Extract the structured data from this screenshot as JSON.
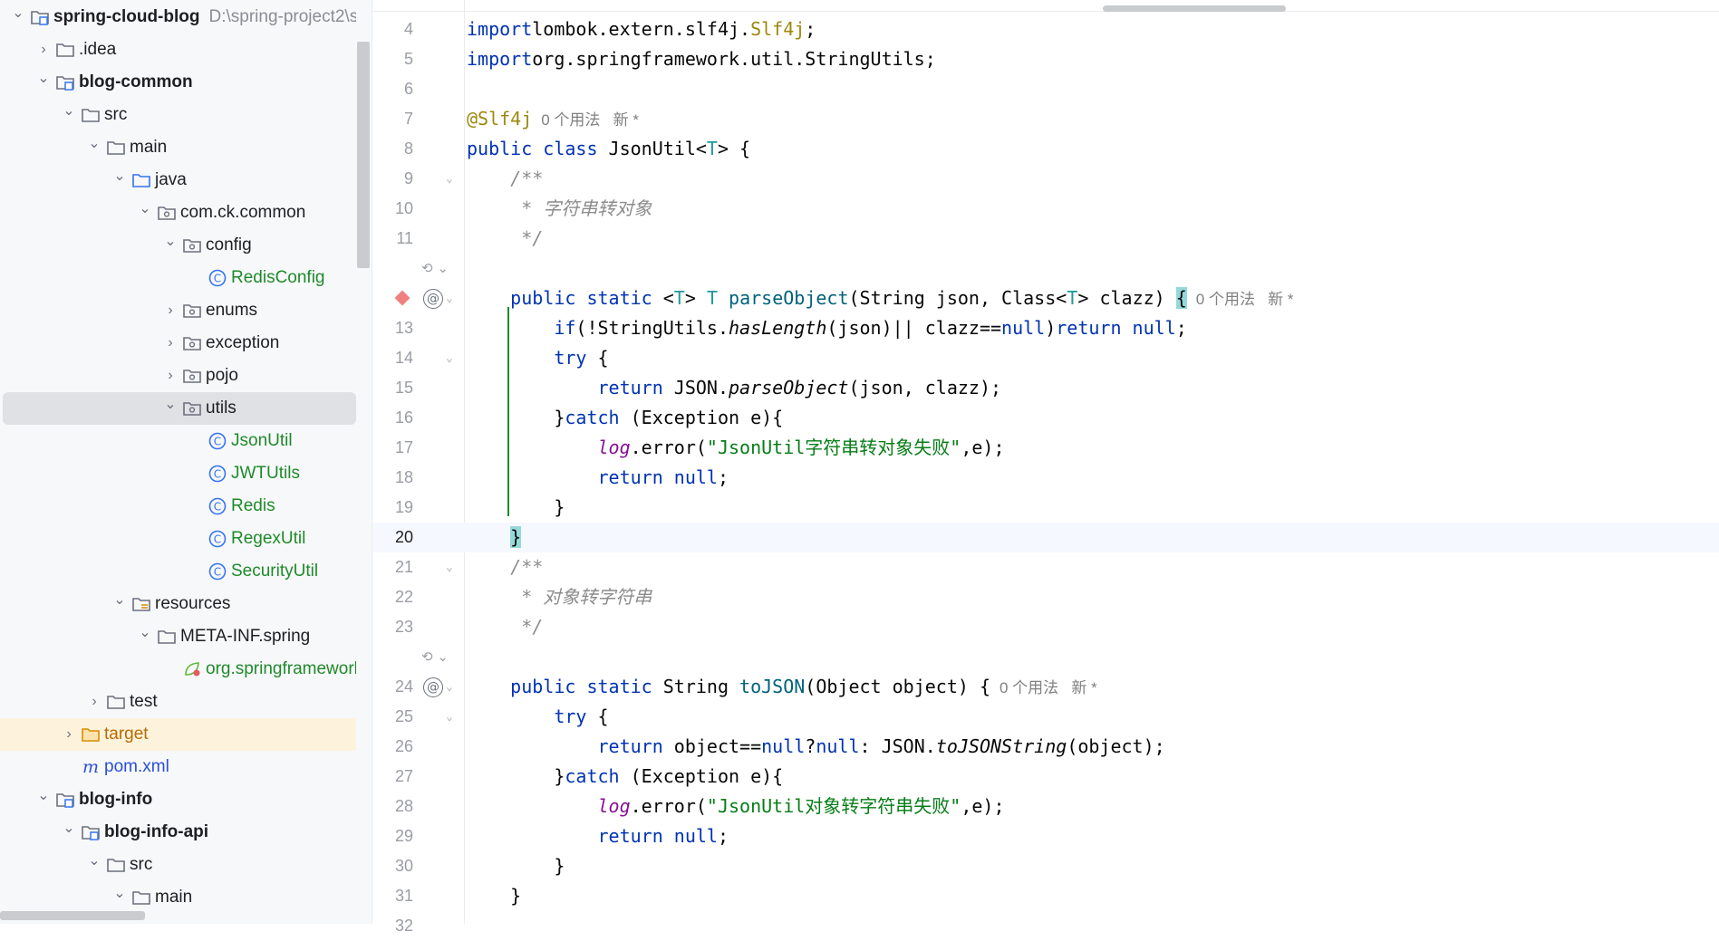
{
  "project_tree": {
    "items": [
      {
        "label": "spring-cloud-blog",
        "path": "D:\\spring-project2\\s",
        "icon": "module-folder-icon",
        "expanded": true,
        "bold": true
      },
      {
        "label": ".idea",
        "icon": "folder-icon",
        "expanded": false
      },
      {
        "label": "blog-common",
        "icon": "module-folder-icon",
        "expanded": true,
        "bold": true
      },
      {
        "label": "src",
        "icon": "folder-icon",
        "expanded": true
      },
      {
        "label": "main",
        "icon": "folder-icon",
        "expanded": true
      },
      {
        "label": "java",
        "icon": "source-folder-icon",
        "expanded": true
      },
      {
        "label": "com.ck.common",
        "icon": "package-icon",
        "expanded": true
      },
      {
        "label": "config",
        "icon": "package-icon",
        "expanded": true
      },
      {
        "label": "RedisConfig",
        "icon": "class-icon"
      },
      {
        "label": "enums",
        "icon": "package-icon",
        "expanded": false
      },
      {
        "label": "exception",
        "icon": "package-icon",
        "expanded": false
      },
      {
        "label": "pojo",
        "icon": "package-icon",
        "expanded": false
      },
      {
        "label": "utils",
        "icon": "package-icon",
        "expanded": true,
        "selected": true
      },
      {
        "label": "JsonUtil",
        "icon": "class-icon"
      },
      {
        "label": "JWTUtils",
        "icon": "class-icon"
      },
      {
        "label": "Redis",
        "icon": "class-icon"
      },
      {
        "label": "RegexUtil",
        "icon": "class-icon"
      },
      {
        "label": "SecurityUtil",
        "icon": "class-icon"
      },
      {
        "label": "resources",
        "icon": "resources-folder-icon",
        "expanded": true
      },
      {
        "label": "META-INF.spring",
        "icon": "folder-icon",
        "expanded": true
      },
      {
        "label": "org.springframework",
        "icon": "spring-file-icon"
      },
      {
        "label": "test",
        "icon": "folder-icon",
        "expanded": false
      },
      {
        "label": "target",
        "icon": "excluded-folder-icon",
        "expanded": false
      },
      {
        "label": "pom.xml",
        "icon": "maven-icon"
      },
      {
        "label": "blog-info",
        "icon": "module-folder-icon",
        "expanded": true,
        "bold": true
      },
      {
        "label": "blog-info-api",
        "icon": "module-folder-icon",
        "expanded": true,
        "bold": true
      },
      {
        "label": "src",
        "icon": "folder-icon",
        "expanded": true
      },
      {
        "label": "main",
        "icon": "folder-icon",
        "expanded": true
      }
    ]
  },
  "editor": {
    "current_line": "20",
    "lines": [
      {
        "n": "4",
        "tokens": [
          [
            "kw",
            "import"
          ],
          [
            "",
            "lombok.extern.slf4j."
          ],
          [
            "ann",
            "Slf4j"
          ],
          [
            "",
            ";"
          ]
        ]
      },
      {
        "n": "5",
        "tokens": [
          [
            "kw",
            "import"
          ],
          [
            "",
            "org.springframework.util.StringUtils;"
          ]
        ]
      },
      {
        "n": "6",
        "tokens": []
      },
      {
        "n": "7",
        "tokens": [
          [
            "ann",
            "@Slf4j"
          ]
        ],
        "hint": "0 个用法   新 *"
      },
      {
        "n": "8",
        "tokens": [
          [
            "kw",
            "public class "
          ],
          [
            "",
            "JsonUtil<"
          ],
          [
            "gen",
            "T"
          ],
          [
            "",
            "> {"
          ]
        ]
      },
      {
        "n": "9",
        "tokens": [
          [
            "cmt",
            "    /**"
          ]
        ]
      },
      {
        "n": "10",
        "tokens": [
          [
            "cmt",
            "     * 字符串转对象"
          ]
        ]
      },
      {
        "n": "11",
        "tokens": [
          [
            "cmt",
            "     */"
          ]
        ]
      },
      {
        "n": "",
        "tokens": [],
        "inlay": "⟲ ⌄"
      },
      {
        "n": "",
        "tokens": [
          [
            "",
            "    "
          ],
          [
            "kw",
            "public static "
          ],
          [
            "",
            "<"
          ],
          [
            "gen",
            "T"
          ],
          [
            "",
            "> "
          ],
          [
            "gen",
            "T "
          ],
          [
            "fn",
            "parseObject"
          ],
          [
            "",
            "(String json, Class<"
          ],
          [
            "gen",
            "T"
          ],
          [
            "",
            "> clazz) "
          ],
          [
            "brace",
            "{"
          ]
        ],
        "hint": "0 个用法   新 *",
        "marks": [
          "breakpoint",
          "at"
        ]
      },
      {
        "n": "13",
        "tokens": [
          [
            "",
            "        "
          ],
          [
            "kw",
            "if"
          ],
          [
            "",
            "(!StringUtils."
          ],
          [
            "sm",
            "hasLength"
          ],
          [
            "",
            "(json)|| clazz=="
          ],
          [
            "kw",
            "null"
          ],
          [
            "",
            ")"
          ],
          [
            "kw",
            "return null"
          ],
          [
            "",
            ";"
          ]
        ]
      },
      {
        "n": "14",
        "tokens": [
          [
            "",
            "        "
          ],
          [
            "kw",
            "try"
          ],
          [
            "",
            " {"
          ]
        ]
      },
      {
        "n": "15",
        "tokens": [
          [
            "",
            "            "
          ],
          [
            "kw",
            "return "
          ],
          [
            "",
            "JSON."
          ],
          [
            "sm",
            "parseObject"
          ],
          [
            "",
            "(json, clazz);"
          ]
        ]
      },
      {
        "n": "16",
        "tokens": [
          [
            "",
            "        }"
          ],
          [
            "kw",
            "catch"
          ],
          [
            "",
            " (Exception e){"
          ]
        ]
      },
      {
        "n": "17",
        "tokens": [
          [
            "",
            "            "
          ],
          [
            "field",
            "log"
          ],
          [
            "",
            ".error("
          ],
          [
            "str",
            "\"JsonUtil字符串转对象失败\""
          ],
          [
            "",
            ",e);"
          ]
        ]
      },
      {
        "n": "18",
        "tokens": [
          [
            "",
            "            "
          ],
          [
            "kw",
            "return null"
          ],
          [
            "",
            ";"
          ]
        ]
      },
      {
        "n": "19",
        "tokens": [
          [
            "",
            "        }"
          ]
        ]
      },
      {
        "n": "20",
        "tokens": [
          [
            "",
            "    "
          ],
          [
            "brace",
            "}"
          ]
        ]
      },
      {
        "n": "21",
        "tokens": [
          [
            "cmt",
            "    /**"
          ]
        ]
      },
      {
        "n": "22",
        "tokens": [
          [
            "cmt",
            "     * 对象转字符串"
          ]
        ]
      },
      {
        "n": "23",
        "tokens": [
          [
            "cmt",
            "     */"
          ]
        ]
      },
      {
        "n": "",
        "tokens": [],
        "inlay": "⟲ ⌄"
      },
      {
        "n": "24",
        "tokens": [
          [
            "",
            "    "
          ],
          [
            "kw",
            "public static "
          ],
          [
            "",
            "String "
          ],
          [
            "fn",
            "toJSON"
          ],
          [
            "",
            "(Object object) {"
          ]
        ],
        "hint": "0 个用法   新 *",
        "marks": [
          "at"
        ]
      },
      {
        "n": "25",
        "tokens": [
          [
            "",
            "        "
          ],
          [
            "kw",
            "try"
          ],
          [
            "",
            " {"
          ]
        ]
      },
      {
        "n": "26",
        "tokens": [
          [
            "",
            "            "
          ],
          [
            "kw",
            "return "
          ],
          [
            "",
            "object=="
          ],
          [
            "kw",
            "null"
          ],
          [
            "",
            "?"
          ],
          [
            "kw",
            "null"
          ],
          [
            "",
            ": JSON."
          ],
          [
            "sm",
            "toJSONString"
          ],
          [
            "",
            "(object);"
          ]
        ]
      },
      {
        "n": "27",
        "tokens": [
          [
            "",
            "        }"
          ],
          [
            "kw",
            "catch"
          ],
          [
            "",
            " (Exception e){"
          ]
        ]
      },
      {
        "n": "28",
        "tokens": [
          [
            "",
            "            "
          ],
          [
            "field",
            "log"
          ],
          [
            "",
            ".error("
          ],
          [
            "str",
            "\"JsonUtil对象转字符串失败\""
          ],
          [
            "",
            ",e);"
          ]
        ]
      },
      {
        "n": "29",
        "tokens": [
          [
            "",
            "            "
          ],
          [
            "kw",
            "return null"
          ],
          [
            "",
            ";"
          ]
        ]
      },
      {
        "n": "30",
        "tokens": [
          [
            "",
            "        }"
          ]
        ]
      },
      {
        "n": "31",
        "tokens": [
          [
            "",
            "    }"
          ]
        ]
      },
      {
        "n": "32",
        "tokens": []
      }
    ]
  },
  "colors": {
    "keyword": "#0033b3",
    "annotation": "#9e880d",
    "string": "#067d17",
    "comment": "#8c8c8c",
    "selection_bg": "#dfe1e5",
    "excluded_bg": "#fdf3dc"
  }
}
